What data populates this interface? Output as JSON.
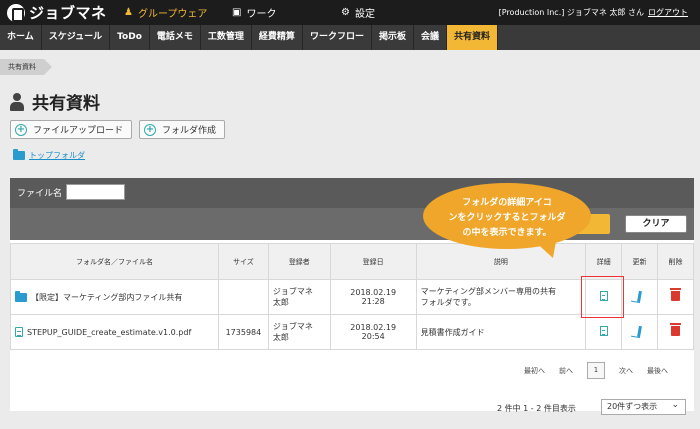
{
  "app": {
    "name": "ジョブマネ"
  },
  "topmenu": {
    "groupware": "グループウェア",
    "work": "ワーク",
    "settings": "設定"
  },
  "user": {
    "label": "[Production Inc.] ジョブマネ 太郎 さん",
    "logout": "ログアウト"
  },
  "nav": [
    "ホーム",
    "スケジュール",
    "ToDo",
    "電話メモ",
    "工数管理",
    "経費精算",
    "ワークフロー",
    "掲示板",
    "会議",
    "共有資料"
  ],
  "breadcrumb": "共有資料",
  "page": {
    "title": "共有資料",
    "upload_label": "ファイルアップロード",
    "create_folder_label": "フォルダ作成",
    "top_folder": "トップフォルダ"
  },
  "search": {
    "file_label": "ファイル名",
    "file_value": "",
    "clear_label": "クリア"
  },
  "table": {
    "headers": [
      "フォルダ名／ファイル名",
      "サイズ",
      "登録者",
      "登録日",
      "説明",
      "詳細",
      "更新",
      "削除"
    ],
    "rows": [
      {
        "name": "【限定】マーケティング部内ファイル共有",
        "size": "",
        "owner1": "ジョブマネ",
        "owner2": "太郎",
        "date": "2018.02.19",
        "time": "21:28",
        "desc1": "マーケティング部メンバー専用の共有",
        "desc2": "フォルダです。"
      },
      {
        "name": "STEPUP_GUIDE_create_estimate.v1.0.pdf",
        "size": "1735984",
        "owner1": "ジョブマネ",
        "owner2": "太郎",
        "date": "2018.02.19",
        "time": "20:54",
        "desc1": "見積書作成ガイド",
        "desc2": ""
      }
    ]
  },
  "pager": {
    "first": "最初へ",
    "prev": "前へ",
    "current": "1",
    "next": "次へ",
    "last": "最後へ",
    "count": "2 件中 1 - 2 件目表示",
    "per_page": "20件ずつ表示"
  },
  "callout": {
    "line1": "フォルダの詳細アイコ",
    "line2": "ンをクリックするとフォルダ",
    "line3": "の中を表示できます。"
  },
  "colors": {
    "accent": "#f3b736",
    "callout": "#f0a62a",
    "link": "#1a8ec8",
    "delete": "#d9392f"
  }
}
